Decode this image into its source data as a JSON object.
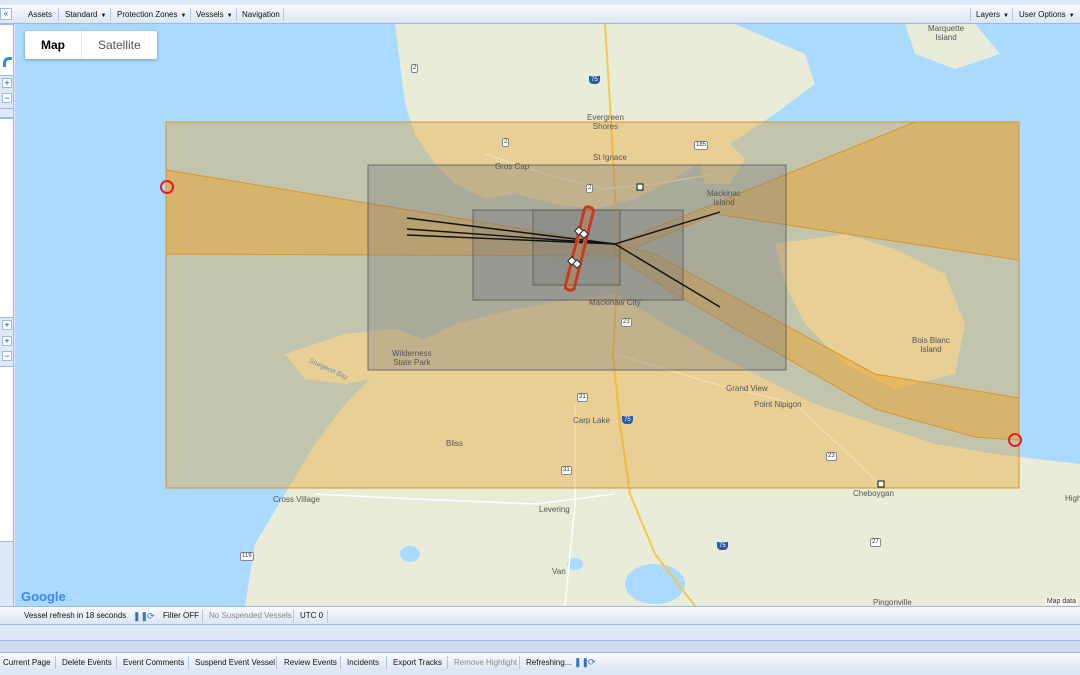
{
  "toolbar": {
    "collapse_icon": "«",
    "assets": "Assets",
    "standard": "Standard",
    "protection_zones": "Protection Zones",
    "vessels": "Vessels",
    "navigation": "Navigation",
    "layers": "Layers",
    "user_options": "User Options",
    "dropdown_caret": "▼"
  },
  "map": {
    "type_map": "Map",
    "type_satellite": "Satellite",
    "google_logo": "Google",
    "attribution": "Map data",
    "places": {
      "marquette_island": "Marquette\nIsland",
      "evergreen_shores": "Evergreen\nShores",
      "gros_cap": "Gros Cap",
      "st_ignace": "St Ignace",
      "mackinac_island": "Mackinac\nIsland",
      "mackinaw_city": "Mackinaw City",
      "bois_blanc_island": "Bois Blanc\nIsland",
      "wilderness_state_park": "Wilderness\nState Park",
      "sturgeon_bay": "Sturgeon Bay",
      "grand_view": "Grand View",
      "point_nipigon": "Point Nipigon",
      "carp_lake": "Carp Lake",
      "bliss": "Bliss",
      "cross_village": "Cross Village",
      "levering": "Levering",
      "cheboygan": "Cheboygan",
      "van": "Van",
      "high": "High",
      "pingonville": "Pingonville"
    },
    "routes": {
      "r2a": "2",
      "r2b": "2",
      "r2c": "2",
      "i75a": "75",
      "i75b": "75",
      "i75c": "75",
      "r185": "185",
      "r23a": "23",
      "r23b": "23",
      "r31a": "31",
      "r31b": "31",
      "r119": "119",
      "r27": "27"
    },
    "colors": {
      "water": "#aadaff",
      "land": "#e8ecd8",
      "zone_fill": "#e8a83a",
      "zone_stroke": "#d9952a",
      "gray_zone": "#7a7a7a",
      "vessel": "#c0392b"
    }
  },
  "status": {
    "vessel_refresh": "Vessel refresh in 18 seconds",
    "pause_icon": "pause-icon",
    "refresh_icon": "refresh-icon",
    "filter": "Filter OFF",
    "suspended": "No Suspended Vessels",
    "utc": "UTC 0"
  },
  "bottom": {
    "current_page": "Current Page",
    "delete_events": "Delete Events",
    "event_comments": "Event Comments",
    "suspend_event_vessel": "Suspend Event Vessel",
    "review_events": "Review Events",
    "incidents": "Incidents",
    "export_tracks": "Export Tracks",
    "remove_highlight": "Remove Highlight",
    "refreshing": "Refreshing..."
  }
}
